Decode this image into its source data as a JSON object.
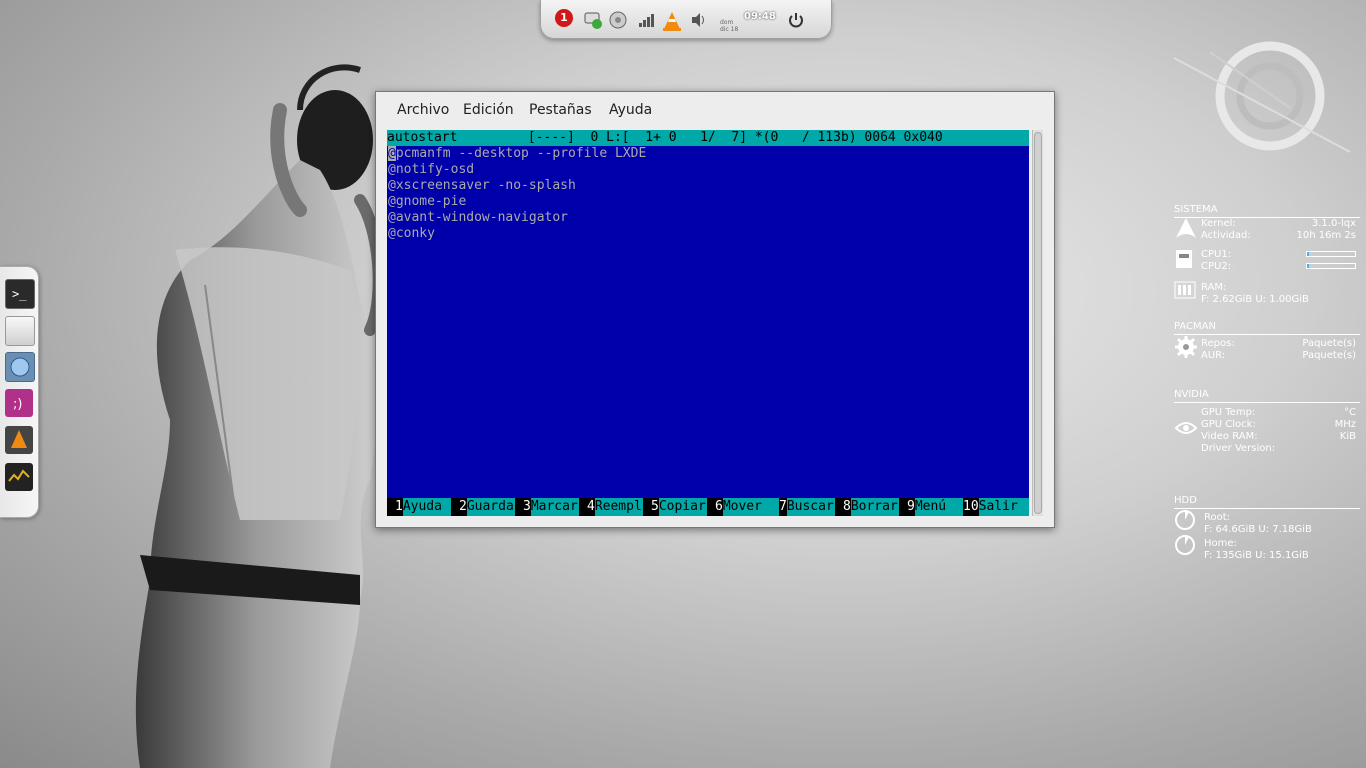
{
  "top_panel": {
    "notification_count": "1",
    "clock": "09:48",
    "date_small": "dom\ndic 18",
    "icons": [
      "notification-icon",
      "chat-icon",
      "settings-icon",
      "signal-icon",
      "vlc-icon",
      "volume-icon",
      "power-icon"
    ]
  },
  "dock": {
    "items": [
      "terminal-icon",
      "file-manager-icon",
      "browser-icon",
      "messenger-icon",
      "vlc-icon",
      "system-monitor-icon"
    ]
  },
  "window": {
    "menu": [
      "Archivo",
      "Edición",
      "Pestañas",
      "Ayuda"
    ],
    "status_line": "autostart         [----]  0 L:[  1+ 0   1/  7] *(0   / 113b) 0064 0x040",
    "lines": [
      "@pcmanfm --desktop --profile LXDE",
      "@notify-osd",
      "@xscreensaver -no-splash",
      "@gnome-pie",
      "@avant-window-navigator",
      "@conky"
    ],
    "fkeys": [
      {
        "num": "1",
        "label": "Ayuda"
      },
      {
        "num": "2",
        "label": "Guarda"
      },
      {
        "num": "3",
        "label": "Marcar"
      },
      {
        "num": "4",
        "label": "Reempl"
      },
      {
        "num": "5",
        "label": "Copiar"
      },
      {
        "num": "6",
        "label": "Mover"
      },
      {
        "num": "7",
        "label": "Buscar"
      },
      {
        "num": "8",
        "label": "Borrar"
      },
      {
        "num": "9",
        "label": "Menú"
      },
      {
        "num": "10",
        "label": "Salir"
      }
    ]
  },
  "conky": {
    "sistema": {
      "title": "SISTEMA",
      "kernel_label": "Kernel:",
      "kernel_value": "3.1.0-lqx",
      "uptime_label": "Actividad:",
      "uptime_value": "10h 16m 2s",
      "cpu1_label": "CPU1:",
      "cpu2_label": "CPU2:",
      "ram_label": "RAM:",
      "ram_detail": "F: 2.62GiB U: 1.00GiB"
    },
    "pacman": {
      "title": "PACMAN",
      "repos_label": "Repos:",
      "repos_unit": "Paquete(s)",
      "aur_label": "AUR:",
      "aur_unit": "Paquete(s)"
    },
    "nvidia": {
      "title": "NVIDIA",
      "gpu_temp_label": "GPU Temp:",
      "gpu_temp_unit": "°C",
      "gpu_clock_label": "GPU Clock:",
      "gpu_clock_unit": "MHz",
      "vram_label": "Video RAM:",
      "vram_unit": "KiB",
      "driver_label": "Driver Version:"
    },
    "hdd": {
      "title": "HDD",
      "root_label": "Root:",
      "root_detail": "F: 64.6GiB U: 7.18GiB",
      "home_label": "Home:",
      "home_detail": "F: 135GiB U: 15.1GiB"
    }
  }
}
